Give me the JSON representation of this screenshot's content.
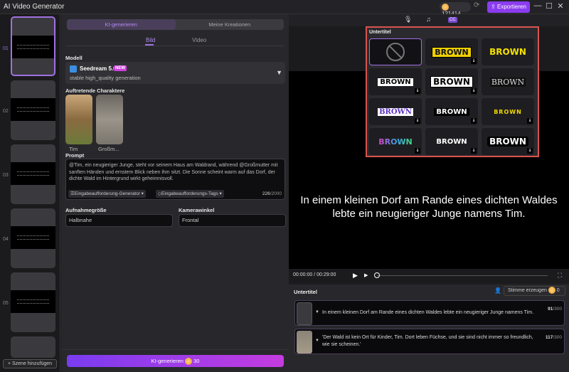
{
  "app": {
    "title": "AI Video Generator",
    "credits": "121414",
    "export_label": "Exportieren"
  },
  "scenes": {
    "items": [
      {
        "num": "01"
      },
      {
        "num": "02"
      },
      {
        "num": "03"
      },
      {
        "num": "04"
      },
      {
        "num": "05"
      }
    ],
    "add_label": "+ Szene hinzufügen"
  },
  "mid": {
    "tabs": [
      "KI-generieren",
      "Meine Kreationen"
    ],
    "sub_tabs": [
      "Bild",
      "Video"
    ],
    "model_label": "Modell",
    "model": {
      "name": "Seedream 5.0",
      "badge": "NEW",
      "desc": "stable high_quality generation"
    },
    "characters_label": "Auftretende Charaktere",
    "characters": [
      {
        "name": "Tim"
      },
      {
        "name": "Großm..."
      }
    ],
    "prompt_label": "Prompt",
    "prompt_text": "@Tim, ein neugieriger Junge, steht vor seinem Haus am Waldrand, während @Großmutter mit sanften Händen und ernstem Blick neben ihm sitzt. Die Sonne scheint warm auf das Dorf, der dichte Wald im Hintergrund wirkt geheimnisvoll.",
    "prompt_generator": "Eingabeaufforderung-Generator ▾",
    "prompt_tags": "Eingabeaufforderungs-Tags ▾",
    "prompt_count": "226",
    "prompt_max": "/2000",
    "shot_label": "Aufnahmegröße",
    "shot_value": "Halbnahe",
    "angle_label": "Kamerawinkel",
    "angle_value": "Frontal",
    "generate_label": "KI-generieren",
    "generate_cost": "30"
  },
  "right": {
    "popup_title": "Untertitel",
    "caption": "In einem kleinen Dorf am Rande eines dichten Waldes lebte ein neugieriger Junge namens Tim.",
    "style_text": "BROWN",
    "time": "00:00:00 / 00:29:00",
    "subtitles_title": "Untertitel",
    "voice_label": "Stimme erzeugen",
    "voice_cost": "0",
    "rows": [
      {
        "text": "In einem kleinen Dorf am Rande eines dichten Waldes lebte ein neugieriger Junge namens Tim.",
        "count": "91",
        "max": "/300"
      },
      {
        "text": "'Der Wald ist kein Ort für Kinder, Tim. Dort leben Füchse, und sie sind nicht immer so freundlich, wie sie scheinen.'",
        "count": "117",
        "max": "/300"
      }
    ]
  }
}
